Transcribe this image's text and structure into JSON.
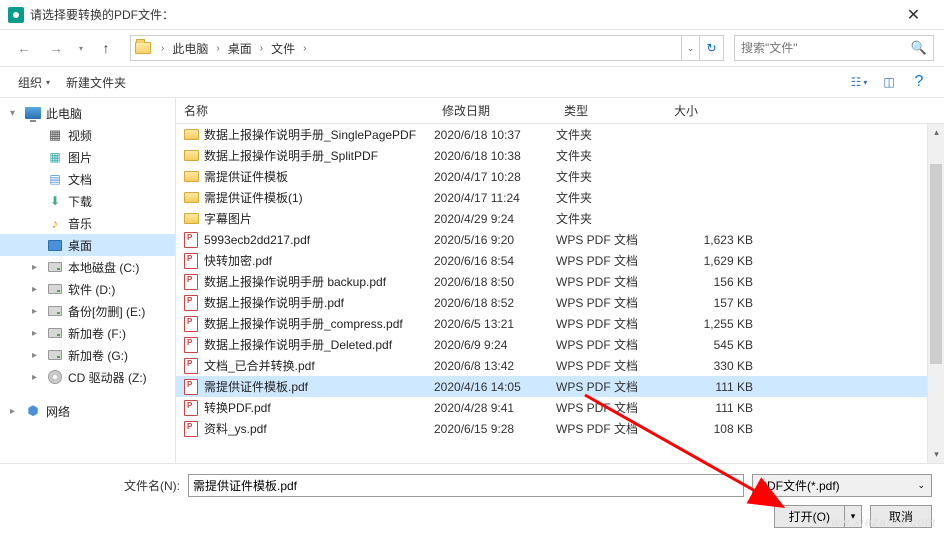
{
  "title": "请选择要转换的PDF文件：",
  "nav": {
    "back": "←",
    "fwd": "→",
    "up": "↑"
  },
  "breadcrumb": {
    "root_sep": "›",
    "items": [
      "此电脑",
      "桌面",
      "文件"
    ]
  },
  "search": {
    "placeholder": "搜索\"文件\""
  },
  "toolbar": {
    "organize": "组织",
    "new_folder": "新建文件夹"
  },
  "sidebar": {
    "items": [
      {
        "label": "此电脑",
        "icon": "pc",
        "exp": "▾",
        "level": 1
      },
      {
        "label": "视频",
        "icon": "video",
        "level": 2
      },
      {
        "label": "图片",
        "icon": "image",
        "level": 2
      },
      {
        "label": "文档",
        "icon": "doc",
        "level": 2
      },
      {
        "label": "下载",
        "icon": "download",
        "level": 2
      },
      {
        "label": "音乐",
        "icon": "music",
        "level": 2
      },
      {
        "label": "桌面",
        "icon": "desktop",
        "level": 2,
        "selected": true
      },
      {
        "label": "本地磁盘 (C:)",
        "icon": "drive",
        "exp": "▸",
        "level": 2
      },
      {
        "label": "软件 (D:)",
        "icon": "drive",
        "exp": "▸",
        "level": 2
      },
      {
        "label": "备份[勿删] (E:)",
        "icon": "drive",
        "exp": "▸",
        "level": 2
      },
      {
        "label": "新加卷 (F:)",
        "icon": "drive",
        "exp": "▸",
        "level": 2
      },
      {
        "label": "新加卷 (G:)",
        "icon": "drive",
        "exp": "▸",
        "level": 2
      },
      {
        "label": "CD 驱动器 (Z:)",
        "icon": "cd",
        "exp": "▸",
        "level": 2
      },
      {
        "label": "网络",
        "icon": "net",
        "exp": "▸",
        "level": 1,
        "gap": true
      }
    ]
  },
  "columns": {
    "name": "名称",
    "date": "修改日期",
    "type": "类型",
    "size": "大小"
  },
  "files": [
    {
      "name": "数据上报操作说明手册_SinglePagePDF",
      "date": "2020/6/18 10:37",
      "type": "文件夹",
      "size": "",
      "icon": "folder"
    },
    {
      "name": "数据上报操作说明手册_SplitPDF",
      "date": "2020/6/18 10:38",
      "type": "文件夹",
      "size": "",
      "icon": "folder"
    },
    {
      "name": "需提供证件模板",
      "date": "2020/4/17 10:28",
      "type": "文件夹",
      "size": "",
      "icon": "folder"
    },
    {
      "name": "需提供证件模板(1)",
      "date": "2020/4/17 11:24",
      "type": "文件夹",
      "size": "",
      "icon": "folder"
    },
    {
      "name": "字幕图片",
      "date": "2020/4/29 9:24",
      "type": "文件夹",
      "size": "",
      "icon": "folder"
    },
    {
      "name": "5993ecb2dd217.pdf",
      "date": "2020/5/16 9:20",
      "type": "WPS PDF 文档",
      "size": "1,623 KB",
      "icon": "pdf"
    },
    {
      "name": "快转加密.pdf",
      "date": "2020/6/16 8:54",
      "type": "WPS PDF 文档",
      "size": "1,629 KB",
      "icon": "pdf"
    },
    {
      "name": "数据上报操作说明手册 backup.pdf",
      "date": "2020/6/18 8:50",
      "type": "WPS PDF 文档",
      "size": "156 KB",
      "icon": "pdf"
    },
    {
      "name": "数据上报操作说明手册.pdf",
      "date": "2020/6/18 8:52",
      "type": "WPS PDF 文档",
      "size": "157 KB",
      "icon": "pdf"
    },
    {
      "name": "数据上报操作说明手册_compress.pdf",
      "date": "2020/6/5 13:21",
      "type": "WPS PDF 文档",
      "size": "1,255 KB",
      "icon": "pdf"
    },
    {
      "name": "数据上报操作说明手册_Deleted.pdf",
      "date": "2020/6/9 9:24",
      "type": "WPS PDF 文档",
      "size": "545 KB",
      "icon": "pdf"
    },
    {
      "name": "文档_已合并转换.pdf",
      "date": "2020/6/8 13:42",
      "type": "WPS PDF 文档",
      "size": "330 KB",
      "icon": "pdf"
    },
    {
      "name": "需提供证件模板.pdf",
      "date": "2020/4/16 14:05",
      "type": "WPS PDF 文档",
      "size": "111 KB",
      "icon": "pdf",
      "selected": true
    },
    {
      "name": "转换PDF.pdf",
      "date": "2020/4/28 9:41",
      "type": "WPS PDF 文档",
      "size": "111 KB",
      "icon": "pdf"
    },
    {
      "name": "资料_ys.pdf",
      "date": "2020/6/15 9:28",
      "type": "WPS PDF 文档",
      "size": "108 KB",
      "icon": "pdf"
    }
  ],
  "filename": {
    "label": "文件名(N):",
    "value": "需提供证件模板.pdf"
  },
  "filter": {
    "label": "PDF文件(*.pdf)"
  },
  "actions": {
    "open": "打开(O)",
    "cancel": "取消"
  },
  "watermark": "www.xiazaiba.com"
}
